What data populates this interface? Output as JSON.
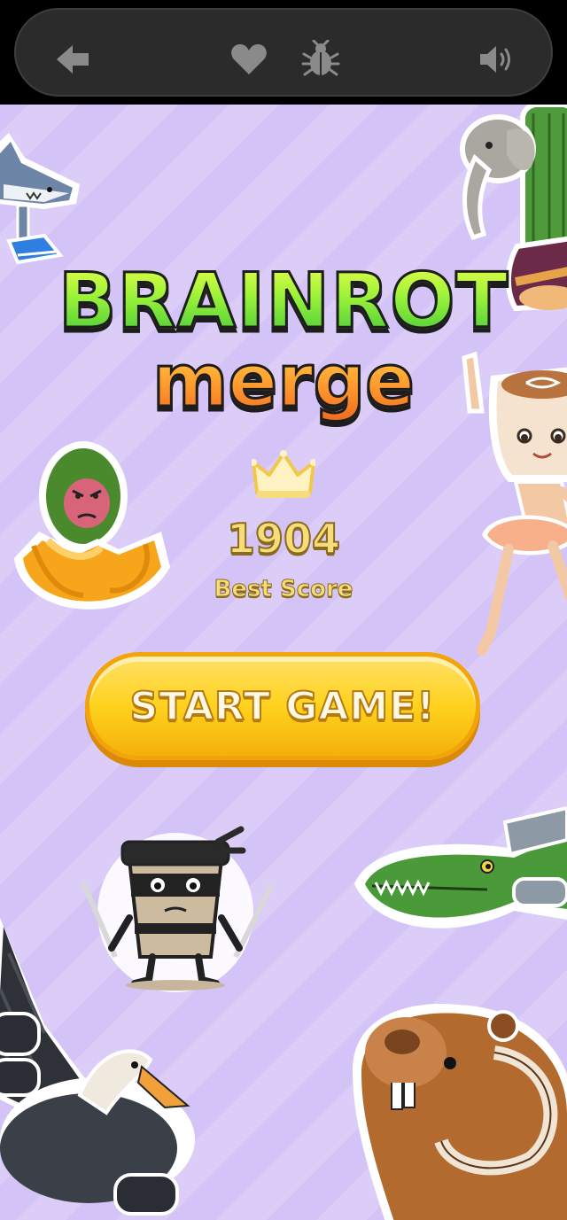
{
  "top_bar": {
    "icons": [
      "back-arrow-icon",
      "heart-icon",
      "bug-icon",
      "speaker-icon"
    ],
    "icon_color": "#8a8a8a"
  },
  "title": {
    "line1": "BRAINROT",
    "line2": "merge"
  },
  "best": {
    "icon": "crown-icon",
    "value": "1904",
    "label": "Best Score"
  },
  "start_button": {
    "label": "START GAME!"
  },
  "colors": {
    "background": "#d4c3f7",
    "button": "#ffd21e",
    "title_green": "#9bf23a",
    "title_orange": "#ff9a2e",
    "score_gold": "#f6dc7a"
  }
}
